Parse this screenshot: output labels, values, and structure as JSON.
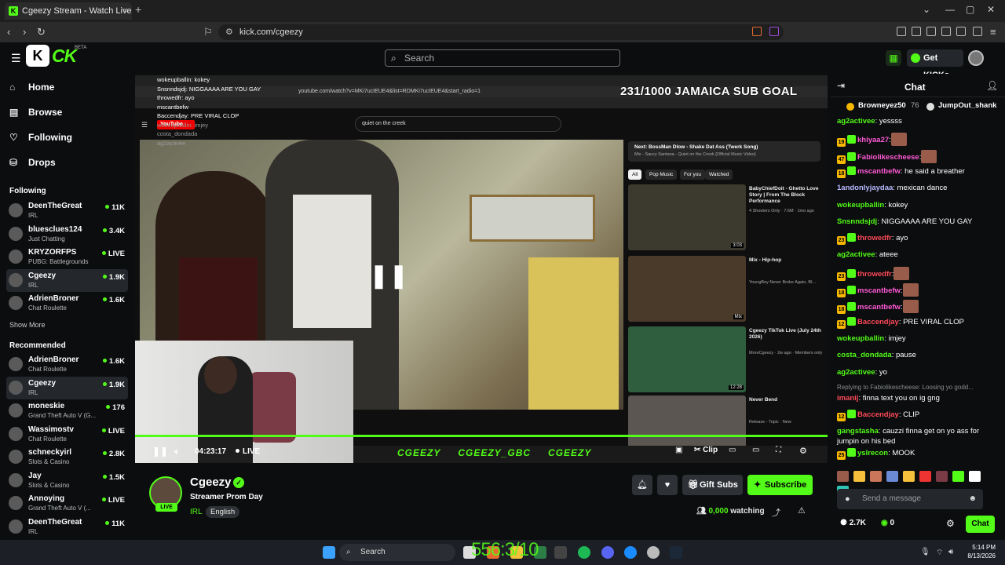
{
  "browser": {
    "tab_title": "Cgeezy Stream - Watch Live o",
    "url": "kick.com/cgeezy"
  },
  "header": {
    "search_placeholder": "Search",
    "get_kicks_label": "Get KICKs",
    "logo_beta": "BETA"
  },
  "sidebar": {
    "nav": [
      "Home",
      "Browse",
      "Following",
      "Drops"
    ],
    "following_heading": "Following",
    "following": [
      {
        "name": "DeenTheGreat",
        "sub": "IRL",
        "viewers": "11K"
      },
      {
        "name": "bluesclues124",
        "sub": "Just Chatting",
        "viewers": "3.4K"
      },
      {
        "name": "KRYZORFPS",
        "sub": "PUBG: Battlegrounds",
        "viewers": "LIVE"
      },
      {
        "name": "Cgeezy",
        "sub": "IRL",
        "viewers": "1.9K"
      },
      {
        "name": "AdrienBroner",
        "sub": "Chat Roulette",
        "viewers": "1.6K"
      }
    ],
    "show_more": "Show More",
    "recommended_heading": "Recommended",
    "recommended": [
      {
        "name": "AdrienBroner",
        "sub": "Chat Roulette",
        "viewers": "1.6K"
      },
      {
        "name": "Cgeezy",
        "sub": "IRL",
        "viewers": "1.9K"
      },
      {
        "name": "moneskie",
        "sub": "Grand Theft Auto V (G...",
        "viewers": "176"
      },
      {
        "name": "Wassimostv",
        "sub": "Chat Roulette",
        "viewers": "LIVE"
      },
      {
        "name": "schneckyirl",
        "sub": "Slots & Casino",
        "viewers": "2.8K"
      },
      {
        "name": "Jay",
        "sub": "Slots & Casino",
        "viewers": "1.5K"
      },
      {
        "name": "Annoying",
        "sub": "Grand Theft Auto V (...",
        "viewers": "LIVE"
      },
      {
        "name": "DeenTheGreat",
        "sub": "IRL",
        "viewers": "11K"
      }
    ]
  },
  "player": {
    "goal_text": "231/1000 JAMAICA SUB GOAL",
    "yt_search": "quiet on the creek",
    "yt_url": "youtube.com/watch?v=MKi7ucIEUE4&list=RDMKi7ucIEUE4&start_radio=1",
    "yt_next": "Next: BossMan Dlow - Shake Dat Ass (Twerk Song)",
    "yt_next_sub": "Mix - Saucy Santana - Quiet on the Creek [Official Music Video]",
    "yt_chips": [
      "All",
      "Pop Music",
      "For you",
      "Watched"
    ],
    "yt_recs": [
      {
        "title": "BabyChiefDoit - Ghetto Love Story | From The Block Performance",
        "meta": "4 Shooters Only · 7.6M · 1mo ago",
        "dur": "3:03"
      },
      {
        "title": "Mix - Hip-hop",
        "meta": "YoungBoy Never Broke Again, BI...",
        "dur": "Mix"
      },
      {
        "title": "Cgeezy TikTok Live (July 24th 2026)",
        "meta": "MoreCgeezy · 2w ago · Members only",
        "dur": "12:28"
      },
      {
        "title": "Never Bend",
        "meta": "Release - Topic · New",
        "dur": ""
      }
    ],
    "overlay_chat": [
      "wokeupballin: kokey",
      "Snsnndsjdj: NIGGAAAA ARE YOU GAY",
      "throwedfr: ayo",
      "mscantbefw",
      "Baccendjay: PRE VIRAL CLOP",
      "wokeupballin: imjey",
      "costa_dondada",
      "ag2activee"
    ],
    "cc_handles": [
      "CGEEZY",
      "CGEEZY_GBC",
      "CGEEZY"
    ],
    "time": "04:23:17",
    "live": "LIVE",
    "clip_label": "Clip"
  },
  "stream": {
    "channel": "Cgeezy",
    "title": "Streamer Prom Day",
    "category": "IRL",
    "language": "English",
    "avatar_live": "LIVE",
    "gift_subs": "Gift Subs",
    "subscribe": "Subscribe",
    "watching_count": "0,000",
    "watching_label": "watching"
  },
  "chat": {
    "title": "Chat",
    "pinned": [
      {
        "name": "Browneyez50",
        "amount": "76"
      },
      {
        "name": "JumpOut_shank",
        "amount": ""
      }
    ],
    "messages": [
      {
        "user": "ag2activee",
        "text": ": yessss",
        "color": "#53fc18"
      },
      {
        "user": "khiyaa27",
        "text": ":",
        "color": "#ff5ad6",
        "emote": true,
        "badge": "19"
      },
      {
        "user": "Fabiolikescheese",
        "text": ":",
        "color": "#ff5ad6",
        "emote": true,
        "badge": "47"
      },
      {
        "user": "mscantbefw",
        "text": ": he said a breather",
        "color": "#ff5ad6",
        "badge": "18"
      },
      {
        "user": "1andonlyjaydaa",
        "text": ": mexican dance",
        "color": "#b9b9ff"
      },
      {
        "user": "wokeupballin",
        "text": ": kokey",
        "color": "#53fc18"
      },
      {
        "user": "Snsnndsjdj",
        "text": ": NIGGAAAA ARE YOU GAY",
        "color": "#53fc18"
      },
      {
        "user": "throwedfr",
        "text": ": ayo",
        "color": "#ff4a5a",
        "badge": "23"
      },
      {
        "user": "ag2activee",
        "text": ": ateee",
        "color": "#53fc18"
      },
      {
        "user": "throwedfr",
        "text": ":",
        "color": "#ff4a5a",
        "emote": true,
        "badge": "23"
      },
      {
        "user": "mscantbefw",
        "text": ":",
        "color": "#ff5ad6",
        "emote": true,
        "badge": "18"
      },
      {
        "user": "mscantbefw",
        "text": ":",
        "color": "#ff5ad6",
        "emote": true,
        "badge": "18"
      },
      {
        "user": "Baccendjay",
        "text": ": PRE VIRAL CLOP",
        "color": "#ff4a5a",
        "badge": "12"
      },
      {
        "user": "wokeupballin",
        "text": ": imjey",
        "color": "#53fc18"
      },
      {
        "user": "costa_dondada",
        "text": ": pause",
        "color": "#53fc18"
      },
      {
        "user": "ag2activee",
        "text": ": yo",
        "color": "#53fc18"
      }
    ],
    "reply_to": "Replying to Fabiolikescheese: Loosing yo godd...",
    "reply_msg": {
      "user": "imanij",
      "text": ": finna text you on ig gng",
      "color": "#ff4a5a"
    },
    "msgs_after": [
      {
        "user": "Baccendjay",
        "text": ": CLIP",
        "color": "#ff4a5a",
        "badge": "12"
      },
      {
        "user": "gangstasha",
        "text": ": cauzzi finna get on yo ass for jumpin on his bed",
        "color": "#53fc18"
      },
      {
        "user": "yslrecon",
        "text": ": MOOK",
        "color": "#53fc18",
        "badge": "25"
      }
    ],
    "input_placeholder": "Send a message",
    "kicks_count": "2.7K",
    "points": "0",
    "send_label": "Chat"
  },
  "taskbar": {
    "search": "Search",
    "time": "5:14 PM",
    "date": "8/13/2026",
    "overlay_counter": "556:3/10"
  },
  "colors": {
    "accent": "#53fc18",
    "bg": "#0b0d0e",
    "panel": "#24272c"
  }
}
